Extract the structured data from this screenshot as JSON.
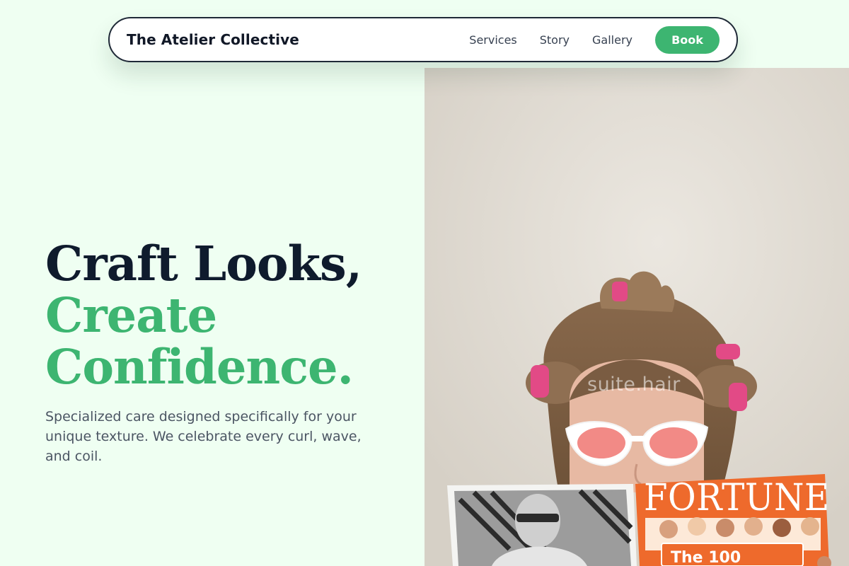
{
  "header": {
    "brand": "The Atelier Collective",
    "nav": [
      {
        "label": "Services"
      },
      {
        "label": "Story"
      },
      {
        "label": "Gallery"
      }
    ],
    "cta_label": "Book"
  },
  "hero": {
    "headline_line1": "Craft Looks,",
    "headline_line2": "Create",
    "headline_line3": "Confidence.",
    "subcopy": "Specialized care designed specifically for your unique texture. We celebrate every curl, wave, and coil."
  },
  "image": {
    "watermark": "suite.hair",
    "magazine_title": "FORTUNE",
    "magazine_subtitle": "The 100"
  },
  "colors": {
    "background": "#effff2",
    "accent": "#3db571",
    "heading": "#0f1b2d",
    "body_text": "#4b5563"
  }
}
